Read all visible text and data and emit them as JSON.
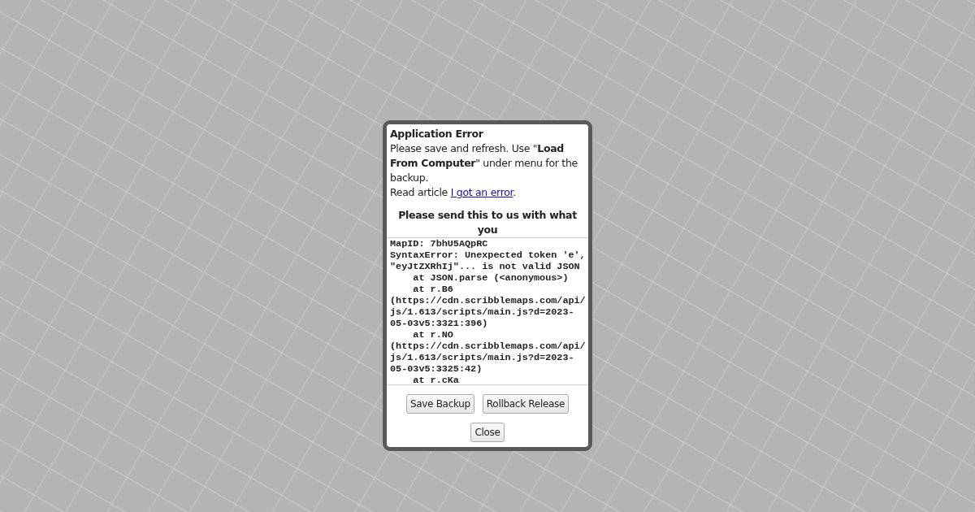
{
  "dialog": {
    "title": "Application Error",
    "message": "Please save and refresh. Use \"**Load From Computer**\" under menu for the backup.",
    "article": {
      "prefix": "Read article",
      "link": "I got an error",
      "suffix": "."
    },
    "send_note": "Please send this to us with what you",
    "log_lines": [
      "MapID: 7bhU5AQpRC",
      "SyntaxError: Unexpected token 'e',",
      "\"eyJtZXRhIj\"... is not valid JSON",
      "    at JSON.parse (<anonymous>)",
      "    at r.B6",
      "(https://cdn.scribblemaps.com/api/",
      "js/1.613/scripts/main.js?d=2023-",
      "05-03v5:3321:396)",
      "    at r.NO",
      "(https://cdn.scribblemaps.com/api/",
      "js/1.613/scripts/main.js?d=2023-",
      "05-03v5:3325:42)",
      "    at r.cKa"
    ],
    "buttons": [
      "Save Backup",
      "Rollback Release"
    ],
    "close": "Close"
  }
}
